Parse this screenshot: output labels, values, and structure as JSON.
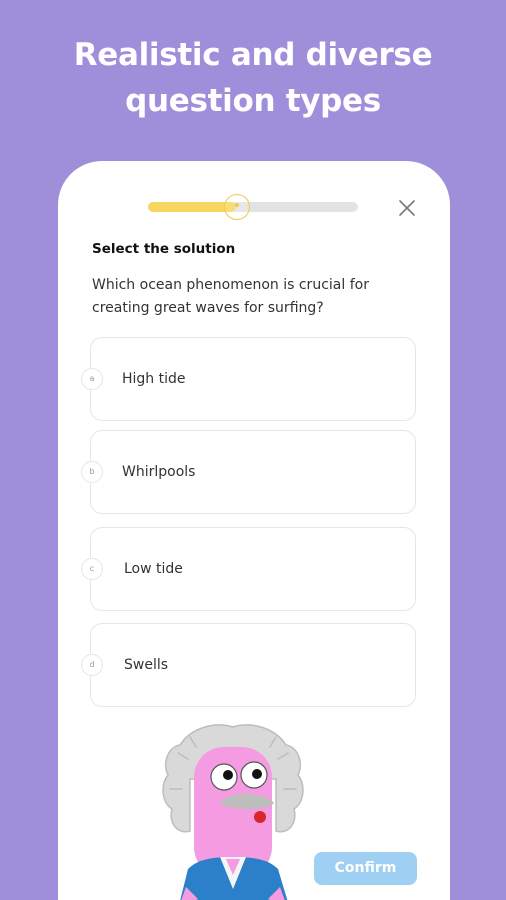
{
  "headline": {
    "line1": "Realistic and diverse",
    "line2": "question types"
  },
  "quiz": {
    "progress": 0.42,
    "prompt": "Select the solution",
    "question_line1": "Which ocean phenomenon is crucial for",
    "question_line2": "creating great waves for surfing?",
    "options": [
      {
        "letter": "a",
        "label": "High tide"
      },
      {
        "letter": "b",
        "label": "Whirlpools"
      },
      {
        "letter": "c",
        "label": "Low tide"
      },
      {
        "letter": "d",
        "label": "Swells"
      }
    ],
    "confirm_label": "Confirm",
    "close_icon": "close-icon"
  },
  "colors": {
    "background": "#9f8fdb",
    "progress_fill": "#f7d660",
    "confirm": "#9fd0f4"
  }
}
